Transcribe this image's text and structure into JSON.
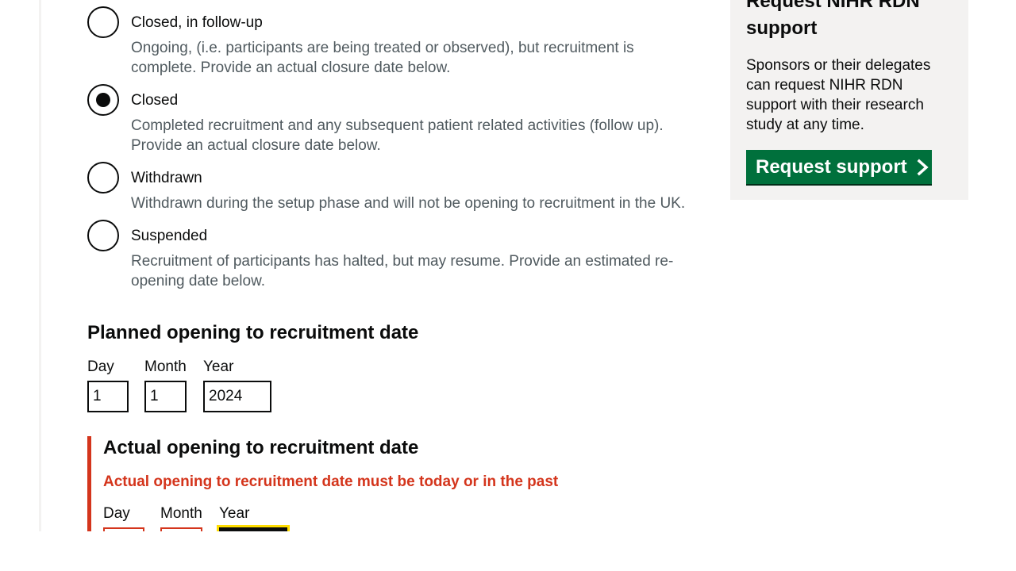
{
  "status_options": [
    {
      "label": "Closed, in follow-up",
      "hint": "Ongoing, (i.e. participants are being treated or observed), but recruitment is complete. Provide an actual closure date below.",
      "checked": false
    },
    {
      "label": "Closed",
      "hint": "Completed recruitment and any subsequent patient related activities (follow up). Provide an actual closure date below.",
      "checked": true
    },
    {
      "label": "Withdrawn",
      "hint": "Withdrawn during the setup phase and will not be opening to recruitment in the UK.",
      "checked": false
    },
    {
      "label": "Suspended",
      "hint": "Recruitment of participants has halted, but may resume. Provide an estimated re-opening date below.",
      "checked": false
    }
  ],
  "planned_opening": {
    "heading": "Planned opening to recruitment date",
    "day_label": "Day",
    "month_label": "Month",
    "year_label": "Year",
    "day_value": "1",
    "month_value": "1",
    "year_value": "2024"
  },
  "actual_opening": {
    "heading": "Actual opening to recruitment date",
    "error": "Actual opening to recruitment date must be today or in the past",
    "day_label": "Day",
    "month_label": "Month",
    "year_label": "Year",
    "day_value": "",
    "month_value": "",
    "year_value": ""
  },
  "sidebar": {
    "title": "Request NIHR RDN support",
    "text": "Sponsors or their delegates can request NIHR RDN support with their research study at any time.",
    "button_label": "Request support",
    "button_icon": "chevron-right-icon"
  },
  "colors": {
    "error": "#d4351c",
    "button_green": "#00703c",
    "focus_yellow": "#ffdd00",
    "hint_grey": "#505a5f",
    "sidebar_bg": "#f3f2f1"
  }
}
